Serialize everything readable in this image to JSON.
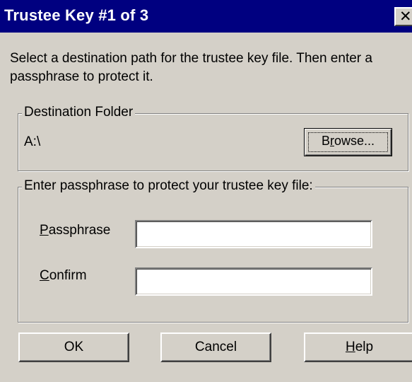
{
  "window": {
    "title": "Trustee Key #1 of 3",
    "close_glyph": "✕",
    "close_icon": "close-icon"
  },
  "instruction": "Select a destination path for the trustee key file.  Then enter a passphrase to protect it.",
  "destination": {
    "legend": "Destination Folder",
    "path": "A:\\",
    "browse": {
      "mnemonic": "r",
      "before": "B",
      "after": "owse..."
    }
  },
  "passphrase_group": {
    "legend": "Enter passphrase to protect your trustee key file:",
    "passphrase": {
      "mnemonic": "P",
      "rest": "assphrase",
      "value": ""
    },
    "confirm": {
      "mnemonic": "C",
      "rest": "onfirm",
      "value": ""
    }
  },
  "buttons": {
    "ok": "OK",
    "cancel": "Cancel",
    "help": {
      "mnemonic": "H",
      "rest": "elp"
    }
  },
  "colors": {
    "titlebar": "#000080",
    "face": "#d4d0c8"
  }
}
